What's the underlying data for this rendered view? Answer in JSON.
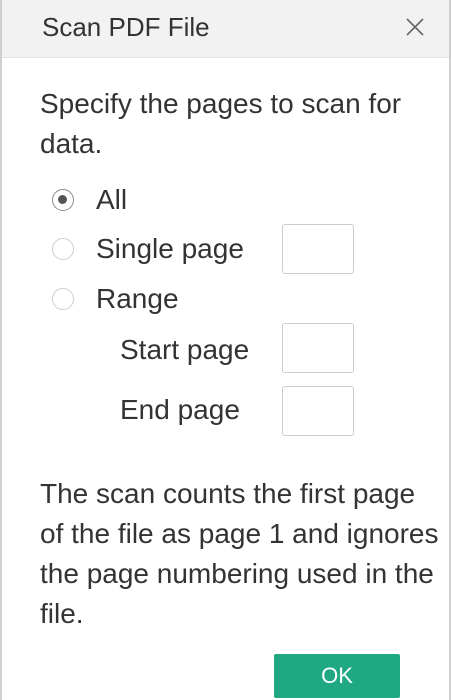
{
  "dialog": {
    "title": "Scan PDF File",
    "instructions": "Specify the pages to scan for data.",
    "options": {
      "all": {
        "label": "All",
        "checked": true
      },
      "single": {
        "label": "Single page",
        "checked": false
      },
      "range": {
        "label": "Range",
        "checked": false
      }
    },
    "fields": {
      "single_page_value": "",
      "start_label": "Start page",
      "start_value": "",
      "end_label": "End page",
      "end_value": ""
    },
    "note": "The scan counts the first page of the file as page 1 and ignores the page numbering used in the file.",
    "ok_label": "OK",
    "icons": {
      "close": "close-icon"
    },
    "colors": {
      "ok_button": "#1fa882",
      "titlebar": "#f2f2f2"
    }
  }
}
